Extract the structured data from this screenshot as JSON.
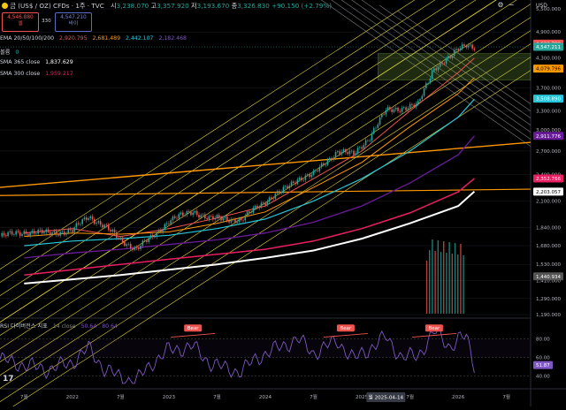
{
  "header": {
    "symbol_icon": "gold-coin-icon",
    "title": "금 (US$ / OZ) CFDs · 1주 · TVC",
    "o_label": "시",
    "o_val": "3,238.070",
    "h_label": "고",
    "h_val": "3,357.920",
    "l_label": "저",
    "l_val": "3,193.670",
    "c_label": "종",
    "c_val": "3,326.830",
    "change": "+90.150 (+2.79%)",
    "bid_price": "4,546.880",
    "bid_label": "셀",
    "spread": "330",
    "ask_price": "4,547.210",
    "ask_label": "바이",
    "currency": "USD"
  },
  "legend": {
    "ema_name": "EMA 20/50/100/200",
    "ema_vals": [
      "2,920.795",
      "2,681.489",
      "2,442.107",
      "2,182.468"
    ],
    "volume_name": "볼륨",
    "volume_val": "0",
    "sma365_name": "SMA 365 close",
    "sma365_val": "1,837.629",
    "sma300_name": "SMA 300 close",
    "sma300_val": "1,959.217"
  },
  "rsi_legend": {
    "name": "RSI 다이버전스 지표",
    "params": "14 close",
    "val1": "50.64",
    "val2": "80.64"
  },
  "colors": {
    "background": "#000000",
    "ema20": "#ef5350",
    "ema50": "#ff9800",
    "ema100": "#26c6da",
    "ema200": "#6a1b9a",
    "sma365": "#ffffff",
    "sma300": "#e91e63",
    "channel": "#ffeb3b",
    "bull": "#26a69a",
    "bear": "#ef5350",
    "rsi": "#7e57c2"
  },
  "chart_data": [
    {
      "type": "candlestick",
      "interval": "1W",
      "y_scale": "log",
      "ylim": [
        1190,
        5600
      ],
      "y_ticks": [
        "5,500.000",
        "4,900.000",
        "4,300.000",
        "3,700.000",
        "3,300.000",
        "3,000.000",
        "2,700.000",
        "2,400.000",
        "2,100.000",
        "1,840.000",
        "1,680.000",
        "1,530.000",
        "1,410.000",
        "1,290.000",
        "1,190.000"
      ],
      "x_ticks": [
        "7월",
        "2022",
        "7월",
        "2023",
        "7월",
        "2024",
        "7월",
        "2025",
        "7월",
        "2026",
        "7월"
      ],
      "crosshair_date": "월 2025-04-14",
      "price_labels": [
        {
          "name": "High",
          "value": "4,622.789",
          "color": "#ef5350"
        },
        {
          "name": "Last",
          "value": "4,547.211",
          "color": "#26a69a"
        },
        {
          "name": "EMA20",
          "value": "4,079.796",
          "color": "#ff9800"
        },
        {
          "name": "EMA50",
          "value": "3,508.890",
          "color": "#26c6da"
        },
        {
          "name": "EMA100",
          "value": "2,911.776",
          "color": "#6a1b9a"
        },
        {
          "name": "SMA300",
          "value": "2,352.766",
          "color": "#e91e63"
        },
        {
          "name": "SMA365",
          "value": "2,203.057",
          "color": "#ffffff"
        },
        {
          "name": "Volume",
          "value": "1,440.934",
          "color": "#555555"
        }
      ],
      "series": [
        {
          "name": "EMA 20",
          "dates": [
            "2021-07",
            "2022-01",
            "2022-07",
            "2023-01",
            "2023-07",
            "2024-01",
            "2024-07",
            "2025-01",
            "2025-07",
            "2026-01",
            "2026-03"
          ],
          "values": [
            1790,
            1830,
            1760,
            1830,
            1930,
            2050,
            2350,
            2700,
            3300,
            4000,
            4300
          ]
        },
        {
          "name": "EMA 50",
          "dates": [
            "2021-07",
            "2022-01",
            "2022-07",
            "2023-01",
            "2023-07",
            "2024-01",
            "2024-07",
            "2025-01",
            "2025-07",
            "2026-01",
            "2026-03"
          ],
          "values": [
            1760,
            1790,
            1780,
            1800,
            1880,
            1990,
            2250,
            2550,
            3050,
            3600,
            3900
          ]
        },
        {
          "name": "EMA 100",
          "dates": [
            "2021-07",
            "2022-01",
            "2022-07",
            "2023-01",
            "2023-07",
            "2024-01",
            "2024-07",
            "2025-01",
            "2025-07",
            "2026-01",
            "2026-03"
          ],
          "values": [
            1680,
            1720,
            1740,
            1770,
            1830,
            1920,
            2100,
            2350,
            2700,
            3200,
            3500
          ]
        },
        {
          "name": "EMA 200",
          "dates": [
            "2021-07",
            "2022-01",
            "2022-07",
            "2023-01",
            "2023-07",
            "2024-01",
            "2024-07",
            "2025-01",
            "2025-07",
            "2026-01",
            "2026-03"
          ],
          "values": [
            1580,
            1620,
            1650,
            1690,
            1730,
            1790,
            1890,
            2050,
            2300,
            2650,
            2912
          ]
        },
        {
          "name": "SMA 300",
          "dates": [
            "2021-07",
            "2022-01",
            "2022-07",
            "2023-01",
            "2023-07",
            "2024-01",
            "2024-07",
            "2025-01",
            "2025-07",
            "2026-01",
            "2026-03"
          ],
          "values": [
            1450,
            1490,
            1530,
            1570,
            1610,
            1650,
            1720,
            1830,
            1980,
            2200,
            2353
          ]
        },
        {
          "name": "SMA 365",
          "dates": [
            "2021-07",
            "2022-01",
            "2022-07",
            "2023-01",
            "2023-07",
            "2024-01",
            "2024-07",
            "2025-01",
            "2025-07",
            "2026-01",
            "2026-03"
          ],
          "values": [
            1390,
            1420,
            1450,
            1490,
            1530,
            1580,
            1640,
            1740,
            1880,
            2050,
            2203
          ]
        }
      ],
      "price_path": {
        "dates": [
          "2021-04",
          "2021-07",
          "2021-10",
          "2022-01",
          "2022-03",
          "2022-05",
          "2022-07",
          "2022-09",
          "2022-11",
          "2023-01",
          "2023-04",
          "2023-06",
          "2023-08",
          "2023-10",
          "2023-12",
          "2024-03",
          "2024-05",
          "2024-07",
          "2024-10",
          "2024-12",
          "2025-02",
          "2025-04",
          "2025-06",
          "2025-08",
          "2025-10",
          "2025-12",
          "2026-01",
          "2026-02",
          "2026-03"
        ],
        "values": [
          1760,
          1800,
          1790,
          1810,
          1950,
          1850,
          1730,
          1650,
          1760,
          1900,
          2000,
          1920,
          1930,
          1900,
          2050,
          2200,
          2350,
          2400,
          2700,
          2650,
          2900,
          3300,
          3350,
          3400,
          4100,
          4300,
          4500,
          4622,
          4547
        ]
      },
      "rsi": {
        "ylim": [
          30,
          95
        ],
        "y_ticks": [
          "80.00",
          "60.00",
          "40.00"
        ],
        "last": "51.87",
        "dates": [
          "2021-04",
          "2021-07",
          "2021-10",
          "2022-01",
          "2022-03",
          "2022-05",
          "2022-07",
          "2022-09",
          "2022-11",
          "2023-01",
          "2023-04",
          "2023-06",
          "2023-08",
          "2023-10",
          "2023-12",
          "2024-03",
          "2024-05",
          "2024-07",
          "2024-10",
          "2024-12",
          "2025-02",
          "2025-04",
          "2025-06",
          "2025-08",
          "2025-10",
          "2025-12",
          "2026-01",
          "2026-02",
          "2026-03"
        ],
        "values": [
          58,
          52,
          47,
          55,
          70,
          48,
          38,
          35,
          55,
          68,
          72,
          55,
          48,
          45,
          60,
          72,
          80,
          65,
          78,
          58,
          70,
          82,
          60,
          62,
          88,
          72,
          80,
          82,
          51.87
        ],
        "divergences": [
          {
            "label": "Bear",
            "date": "2023-04"
          },
          {
            "label": "Bear",
            "date": "2024-11"
          },
          {
            "label": "Bear",
            "date": "2025-10"
          }
        ]
      }
    }
  ]
}
